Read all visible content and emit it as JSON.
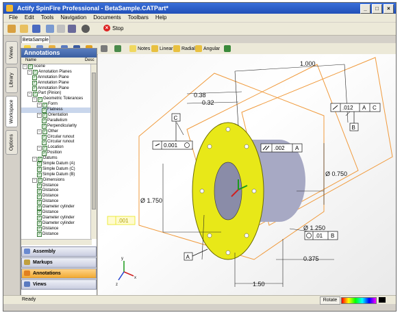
{
  "window": {
    "title": "Actify SpinFire Professional - BetaSample.CATPart*",
    "buttons": [
      "_",
      "□",
      "×"
    ]
  },
  "menu": [
    "File",
    "Edit",
    "Tools",
    "Navigation",
    "Documents",
    "Toolbars",
    "Help"
  ],
  "toolbar1": {
    "stop_label": "Stop"
  },
  "document_tab": "BetaSample",
  "toolbar2": {
    "notes": "Notes",
    "linear": "Linear",
    "radial": "Radial",
    "angular": "Angular"
  },
  "side_tabs": [
    "Views",
    "Library",
    "Workspace",
    "Options"
  ],
  "panel": {
    "title": "Annotations",
    "columns": [
      "Name",
      "Desc"
    ],
    "tree": [
      {
        "label": "Scene",
        "depth": 0,
        "expander": "−"
      },
      {
        "label": "Annotation Planes",
        "depth": 1,
        "expander": "−"
      },
      {
        "label": "Annotation Plane",
        "depth": 2
      },
      {
        "label": "Annotation Plane",
        "depth": 2
      },
      {
        "label": "Annotation Plane",
        "depth": 2
      },
      {
        "label": "Part (Pinion)",
        "depth": 1,
        "expander": "−"
      },
      {
        "label": "Geometric Tolerances",
        "depth": 2,
        "expander": "−"
      },
      {
        "label": "Form",
        "depth": 3,
        "expander": "−"
      },
      {
        "label": "Flatness",
        "depth": 4,
        "selected": true
      },
      {
        "label": "Orientation",
        "depth": 3,
        "expander": "−"
      },
      {
        "label": "Parallelism",
        "depth": 4
      },
      {
        "label": "Perpendicularity",
        "depth": 4
      },
      {
        "label": "Other",
        "depth": 3,
        "expander": "−"
      },
      {
        "label": "Circular runout",
        "depth": 4
      },
      {
        "label": "Circular runout",
        "depth": 4
      },
      {
        "label": "Location",
        "depth": 3,
        "expander": "−"
      },
      {
        "label": "Position",
        "depth": 4
      },
      {
        "label": "Datums",
        "depth": 2,
        "expander": "−"
      },
      {
        "label": "Simple Datum (A)",
        "depth": 3
      },
      {
        "label": "Simple Datum (C)",
        "depth": 3
      },
      {
        "label": "Simple Datum (B)",
        "depth": 3
      },
      {
        "label": "Dimensions",
        "depth": 2,
        "expander": "−"
      },
      {
        "label": "Distance",
        "depth": 3
      },
      {
        "label": "Distance",
        "depth": 3
      },
      {
        "label": "Distance",
        "depth": 3
      },
      {
        "label": "Distance",
        "depth": 3
      },
      {
        "label": "Diameter cylinder",
        "depth": 3
      },
      {
        "label": "Distance",
        "depth": 3
      },
      {
        "label": "Diameter cylinder",
        "depth": 3
      },
      {
        "label": "Diameter cylinder",
        "depth": 3
      },
      {
        "label": "Distance",
        "depth": 3
      },
      {
        "label": "Distance",
        "depth": 3
      }
    ]
  },
  "nav_buttons": [
    {
      "label": "Assembly",
      "color": "#6a8ad0"
    },
    {
      "label": "Markups",
      "color": "#c0a040"
    },
    {
      "label": "Annotations",
      "color": "#e08020",
      "active": true
    },
    {
      "label": "Views",
      "color": "#5a7ac0"
    }
  ],
  "drawing": {
    "dims": {
      "d1000": "1.000",
      "d038": "0.38",
      "d032": "0.32",
      "d0750": "Ø 0.750",
      "d1750": "Ø 1.750",
      "d1250": "Ø 1.250",
      "d0375": "0.375",
      "d150": "1.50"
    },
    "fcf": {
      "runout_top": [
        ".012",
        "A",
        "C"
      ],
      "flatness": "0.001",
      "parallel": ".002",
      "parallel_datum": "A",
      "position": ".01",
      "position_datum": "B",
      "yellow": ".001"
    },
    "datums": {
      "c": "C",
      "b": "B",
      "a": "A"
    },
    "colors": {
      "flange": "#e8e818",
      "frame": "#f09a3c",
      "hub": "#a7a9c4"
    }
  },
  "status": {
    "ready": "Ready",
    "mode": "Rotate"
  }
}
